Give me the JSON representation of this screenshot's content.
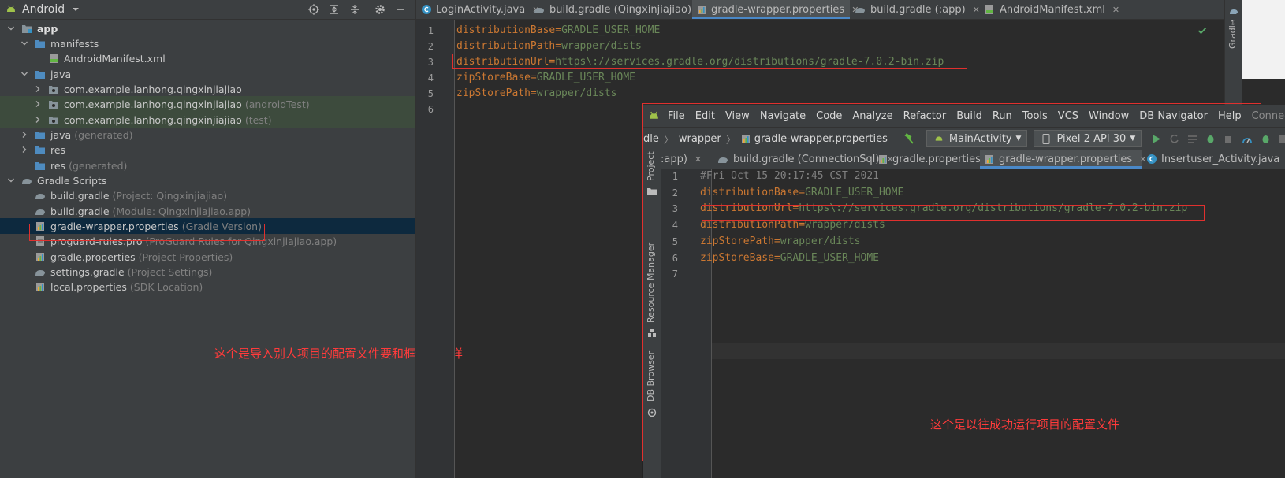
{
  "project_panel": {
    "view_label": "Android",
    "tree": [
      {
        "label": "app",
        "sub": "",
        "icon": "module-folder-icon",
        "bold": true
      },
      {
        "label": "manifests",
        "sub": "",
        "icon": "folder-icon"
      },
      {
        "label": "AndroidManifest.xml",
        "sub": "",
        "icon": "manifest-file-icon"
      },
      {
        "label": "java",
        "sub": "",
        "icon": "folder-icon"
      },
      {
        "label": "com.example.lanhong.qingxinjiajiao",
        "sub": "",
        "icon": "package-icon"
      },
      {
        "label": "com.example.lanhong.qingxinjiajiao",
        "sub": "(androidTest)",
        "icon": "package-icon"
      },
      {
        "label": "com.example.lanhong.qingxinjiajiao",
        "sub": "(test)",
        "icon": "package-icon"
      },
      {
        "label": "java",
        "sub": "(generated)",
        "icon": "folder-icon"
      },
      {
        "label": "res",
        "sub": "",
        "icon": "folder-icon"
      },
      {
        "label": "res",
        "sub": "(generated)",
        "icon": "folder-icon"
      },
      {
        "label": "Gradle Scripts",
        "sub": "",
        "icon": "gradle-icon"
      },
      {
        "label": "build.gradle",
        "sub": "(Project: Qingxinjiajiao)",
        "icon": "gradle-file-icon"
      },
      {
        "label": "build.gradle",
        "sub": "(Module: Qingxinjiajiao.app)",
        "icon": "gradle-file-icon"
      },
      {
        "label": "gradle-wrapper.properties",
        "sub": "(Gradle Version)",
        "icon": "properties-file-icon"
      },
      {
        "label": "proguard-rules.pro",
        "sub": "(ProGuard Rules for Qingxinjiajiao.app)",
        "icon": "text-file-icon"
      },
      {
        "label": "gradle.properties",
        "sub": "(Project Properties)",
        "icon": "properties-file-icon"
      },
      {
        "label": "settings.gradle",
        "sub": "(Project Settings)",
        "icon": "gradle-file-icon"
      },
      {
        "label": "local.properties",
        "sub": "(SDK Location)",
        "icon": "properties-file-icon"
      }
    ]
  },
  "editor_tabs": [
    {
      "label": "LoginActivity.java",
      "icon": "java-class-icon"
    },
    {
      "label": "build.gradle (Qingxinjiajiao)",
      "icon": "gradle-file-icon"
    },
    {
      "label": "gradle-wrapper.properties",
      "icon": "properties-file-icon",
      "active": true
    },
    {
      "label": "build.gradle (:app)",
      "icon": "gradle-file-icon"
    },
    {
      "label": "AndroidManifest.xml",
      "icon": "manifest-file-icon"
    }
  ],
  "editor": {
    "lines": [
      {
        "num": "1",
        "key": "distributionBase",
        "value": "GRADLE_USER_HOME"
      },
      {
        "num": "2",
        "key": "distributionPath",
        "value": "wrapper/dists"
      },
      {
        "num": "3",
        "key": "distributionUrl",
        "value": "https\\://services.gradle.org/distributions/gradle-7.0.2-bin.zip"
      },
      {
        "num": "4",
        "key": "zipStoreBase",
        "value": "GRADLE_USER_HOME"
      },
      {
        "num": "5",
        "key": "zipStorePath",
        "value": "wrapper/dists"
      },
      {
        "num": "6",
        "key": "",
        "value": ""
      }
    ]
  },
  "right_strip": {
    "label": "Gradle"
  },
  "overlay": {
    "menu": [
      "File",
      "Edit",
      "View",
      "Navigate",
      "Code",
      "Analyze",
      "Refactor",
      "Build",
      "Run",
      "Tools",
      "VCS",
      "Window",
      "DB Navigator",
      "Help"
    ],
    "project_name": "ConnectionSql",
    "breadcrumb": [
      "dle",
      "wrapper",
      "gradle-wrapper.properties"
    ],
    "run_config": "MainActivity",
    "device": "Pixel 2 API 30",
    "tabs": [
      {
        "label": ":app)",
        "icon": ""
      },
      {
        "label": "build.gradle (ConnectionSql)",
        "icon": "gradle-file-icon"
      },
      {
        "label": "gradle.properties",
        "icon": "properties-file-icon"
      },
      {
        "label": "gradle-wrapper.properties",
        "icon": "properties-file-icon",
        "active": true
      },
      {
        "label": "Insertuser_Activity.java",
        "icon": "java-class-icon"
      }
    ],
    "side_tools": [
      "Project",
      "Resource Manager",
      "DB Browser"
    ],
    "lines": [
      {
        "num": "1",
        "comment": "#Fri Oct 15 20:17:45 CST 2021",
        "key": "",
        "value": ""
      },
      {
        "num": "2",
        "comment": "",
        "key": "distributionBase",
        "value": "GRADLE_USER_HOME"
      },
      {
        "num": "3",
        "comment": "",
        "key": "distributionUrl",
        "value": "https\\://services.gradle.org/distributions/gradle-7.0.2-bin.zip"
      },
      {
        "num": "4",
        "comment": "",
        "key": "distributionPath",
        "value": "wrapper/dists"
      },
      {
        "num": "5",
        "comment": "",
        "key": "zipStorePath",
        "value": "wrapper/dists"
      },
      {
        "num": "6",
        "comment": "",
        "key": "zipStoreBase",
        "value": "GRADLE_USER_HOME"
      },
      {
        "num": "7",
        "comment": "",
        "key": "",
        "value": ""
      }
    ]
  },
  "annotations": {
    "left_note": "这个是导入别人项目的配置文件要和框选的一样",
    "right_note": "这个是以往成功运行项目的配置文件"
  },
  "colors": {
    "accent": "#4a88c7",
    "annotation": "#e0302e",
    "key": "#cc7832",
    "value": "#6a8759"
  }
}
